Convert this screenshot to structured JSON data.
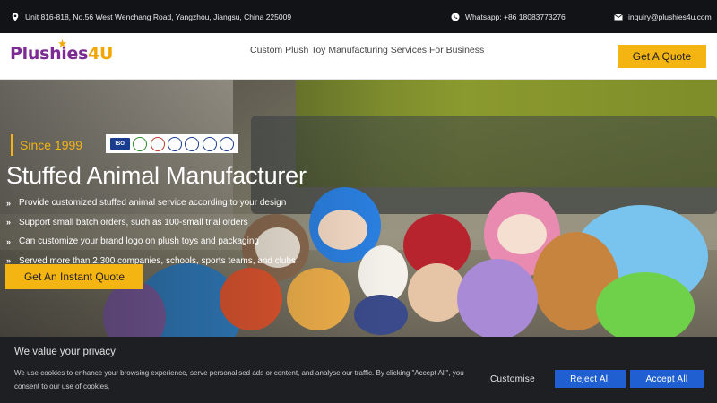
{
  "topbar": {
    "address": "Unit 816-818, No.56 West Wenchang Road, Yangzhou, Jiangsu, China 225009",
    "whatsapp": "Whatsapp: +86 18083773276",
    "email": "inquiry@plushies4u.com",
    "icons": [
      "location-pin-icon",
      "whatsapp-icon",
      "envelope-icon"
    ]
  },
  "header": {
    "logo_part1": "Plushies",
    "logo_part2": "4U",
    "tagline": "Custom Plush Toy Manufacturing Services For Business",
    "quote_button": "Get A Quote"
  },
  "hero": {
    "since": "Since 1999",
    "cert_iso": "ISO",
    "title": "Stuffed Animal Manufacturer",
    "bullets": [
      "Provide customized stuffed animal service according to your design",
      "Support small batch orders, such as 100-small trial orders",
      "Can customize your brand logo on plush toys and packaging",
      "Served more than 2,300 companies, schools, sports teams, and clubs"
    ],
    "cta": "Get An Instant Quote"
  },
  "cookie": {
    "title": "We value your privacy",
    "text": "We use cookies to enhance your browsing experience, serve personalised ads or content, and analyse our traffic. By clicking \"Accept All\", you consent to our use of cookies.",
    "customise": "Customise",
    "reject": "Reject All",
    "accept": "Accept All"
  },
  "colors": {
    "accent": "#f4b412",
    "brand_purple": "#7b2b93",
    "button_blue": "#1f5fd1"
  }
}
